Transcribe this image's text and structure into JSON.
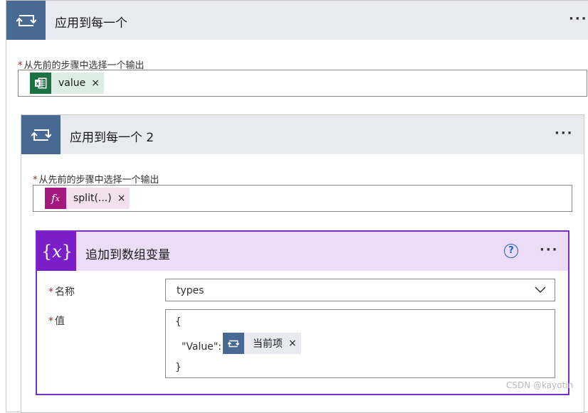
{
  "outer": {
    "title": "应用到每一个",
    "more": "···",
    "field_required": "*",
    "field_label": "从先前的步骤中选择一个输出",
    "token": {
      "icon": "excel-icon",
      "text": "value",
      "remove": "×",
      "bg": "#dceee3",
      "icon_bg": "#1e7145"
    }
  },
  "inner": {
    "title": "应用到每一个 2",
    "more": "···",
    "field_required": "*",
    "field_label": "从先前的步骤中选择一个输出",
    "token": {
      "icon": "fx-icon",
      "text": "split(...)",
      "remove": "×",
      "bg": "#f3e0ee",
      "icon_bg": "#a4197e"
    }
  },
  "action": {
    "title": "追加到数组变量",
    "help_icon": "help-icon",
    "more": "···",
    "name_required": "*",
    "name_label": "名称",
    "name_value": "types",
    "value_required": "*",
    "value_label": "值",
    "value_open": "{",
    "value_key": "\"Value\":",
    "value_token": {
      "icon": "loop-icon",
      "text": "当前项",
      "remove": "×"
    },
    "value_close": "}"
  },
  "watermark": "CSDN @kayotin",
  "colors": {
    "loop_header": "#486991",
    "variable_header": "#7a1fc7",
    "variable_border": "#7a2ec6"
  }
}
